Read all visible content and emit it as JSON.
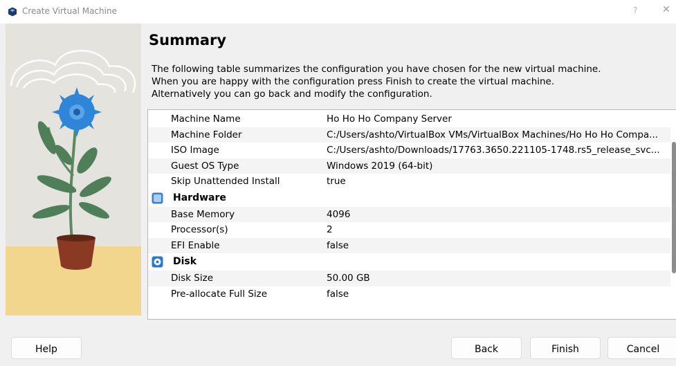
{
  "window": {
    "title": "Create Virtual Machine",
    "help_glyph": "?",
    "close_glyph": "✕"
  },
  "page": {
    "heading": "Summary",
    "description": [
      "The following table summarizes the configuration you have chosen for the new virtual machine.",
      "When you are happy with the configuration press Finish to create the virtual machine.",
      "Alternatively you can go back and modify the configuration."
    ]
  },
  "summary": {
    "general": [
      {
        "key": "Machine Name",
        "value": "Ho Ho Ho Company Server"
      },
      {
        "key": "Machine Folder",
        "value": "C:/Users/ashto/VirtualBox VMs/VirtualBox Machines/Ho Ho Ho Compa..."
      },
      {
        "key": "ISO Image",
        "value": "C:/Users/ashto/Downloads/17763.3650.221105-1748.rs5_release_svc..."
      },
      {
        "key": "Guest OS Type",
        "value": "Windows 2019 (64-bit)"
      },
      {
        "key": "Skip Unattended Install",
        "value": "true"
      }
    ],
    "hardware": {
      "label": "Hardware",
      "icon": "chip-icon",
      "rows": [
        {
          "key": "Base Memory",
          "value": "4096"
        },
        {
          "key": "Processor(s)",
          "value": "2"
        },
        {
          "key": "EFI Enable",
          "value": "false"
        }
      ]
    },
    "disk": {
      "label": "Disk",
      "icon": "disk-icon",
      "rows": [
        {
          "key": "Disk Size",
          "value": "50.00 GB"
        },
        {
          "key": "Pre-allocate Full Size",
          "value": "false"
        }
      ]
    }
  },
  "buttons": {
    "help": "Help",
    "back": "Back",
    "finish": "Finish",
    "cancel": "Cancel"
  },
  "colors": {
    "accent_blue": "#2f86d8",
    "side_panel": "#e3e2dd",
    "floor_yellow": "#f2d58a"
  }
}
